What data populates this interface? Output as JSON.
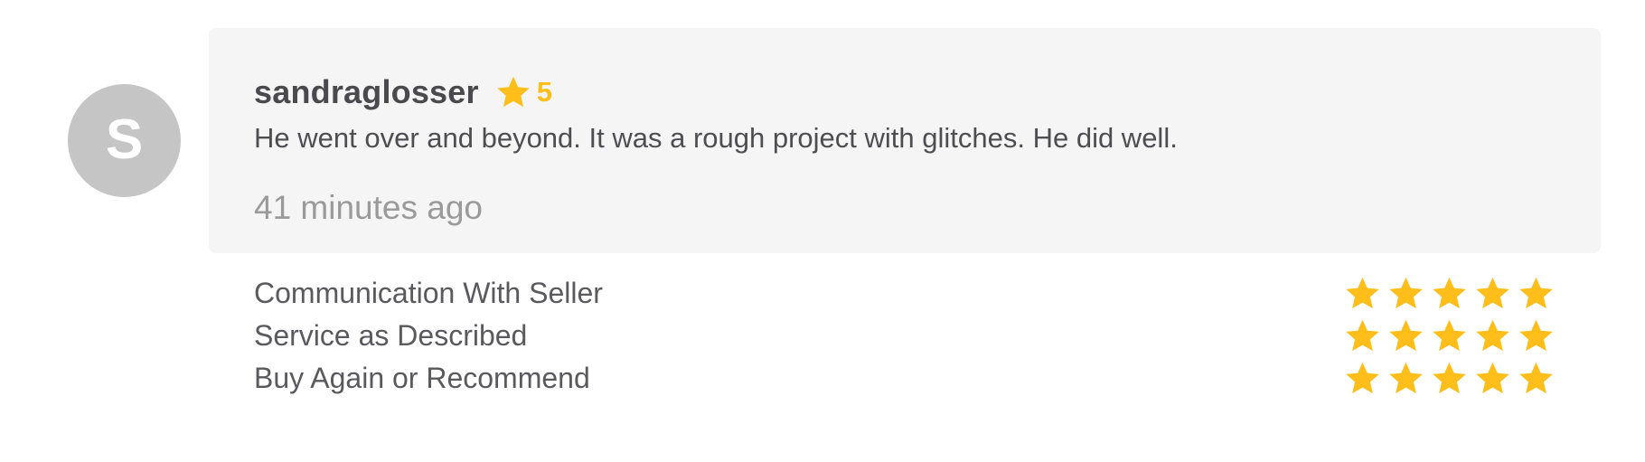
{
  "avatar": {
    "initial": "S",
    "background": "#c5c5c5"
  },
  "review": {
    "username": "sandraglosser",
    "rating": "5",
    "text": "He went over and beyond. It was a rough project with glitches. He did well.",
    "timestamp": "41 minutes ago"
  },
  "breakdown": [
    {
      "label": "Communication With Seller",
      "stars": 5
    },
    {
      "label": "Service as Described",
      "stars": 5
    },
    {
      "label": "Buy Again or Recommend",
      "stars": 5
    }
  ],
  "icons": {
    "rating": "star-icon"
  },
  "colors": {
    "star": "#ffbe1a",
    "card_background": "#f5f5f5",
    "timestamp": "#9a9a9a"
  }
}
